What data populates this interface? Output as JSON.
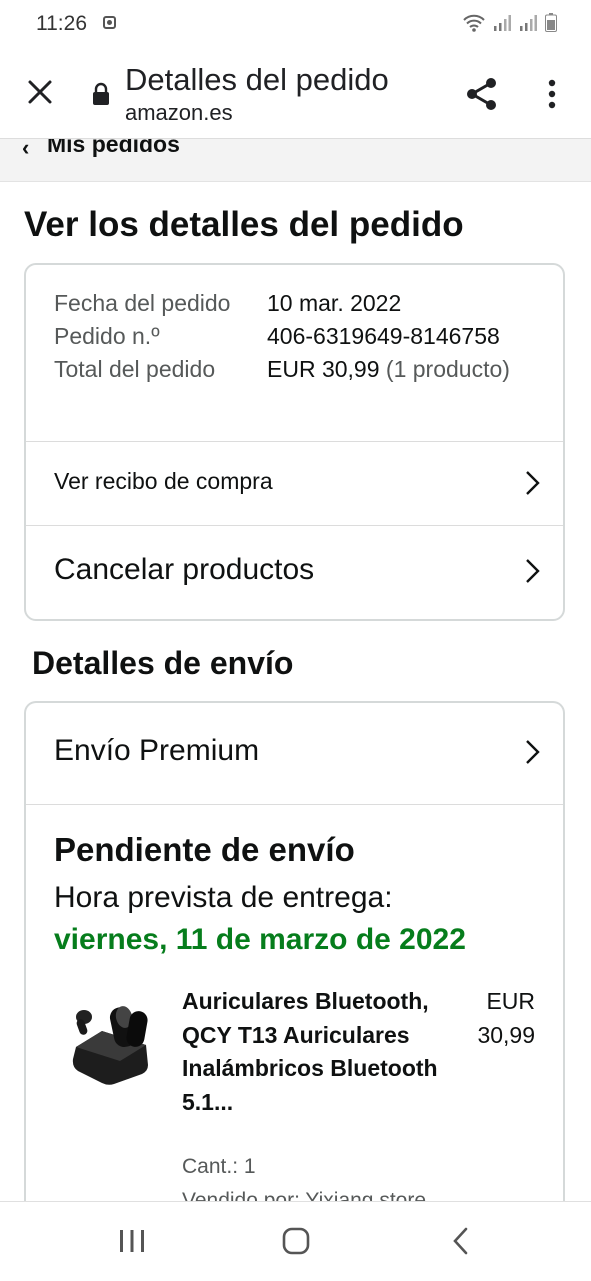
{
  "status_bar": {
    "time": "11:26",
    "icons": [
      "photo-icon",
      "wifi-icon",
      "signal-icon",
      "signal-icon",
      "battery-icon"
    ]
  },
  "toolbar": {
    "title": "Detalles del pedido",
    "url": "amazon.es",
    "icons": [
      "close-icon",
      "lock-icon",
      "share-icon",
      "more-vert-icon"
    ]
  },
  "breadcrumb": {
    "label": "Mis pedidos"
  },
  "page": {
    "title": "Ver los detalles del pedido"
  },
  "order_summary": {
    "date_label": "Fecha del pedido",
    "date_value": "10 mar. 2022",
    "number_label": "Pedido n.º",
    "number_value": "406-6319649-8146758",
    "total_label": "Total del pedido",
    "total_value": "EUR 30,99",
    "total_count": "(1 producto)"
  },
  "actions": {
    "receipt": "Ver recibo de compra",
    "cancel": "Cancelar productos"
  },
  "shipping": {
    "section_title": "Detalles de envío",
    "method": "Envío Premium",
    "status": "Pendiente de envío",
    "eta_label": "Hora prevista de entrega:",
    "eta_date": "viernes, 11 de marzo de 2022"
  },
  "product": {
    "name": "Auriculares Bluetooth, QCY T13 Auriculares Inalámbricos Bluetooth 5.1...",
    "price": "EUR 30,99",
    "qty": "Cant.: 1",
    "seller": "Vendido por: Yixiang store"
  },
  "colors": {
    "accent_green": "#067d1c",
    "border": "#d5d9d9",
    "text": "#0f1111",
    "muted": "#565959"
  }
}
